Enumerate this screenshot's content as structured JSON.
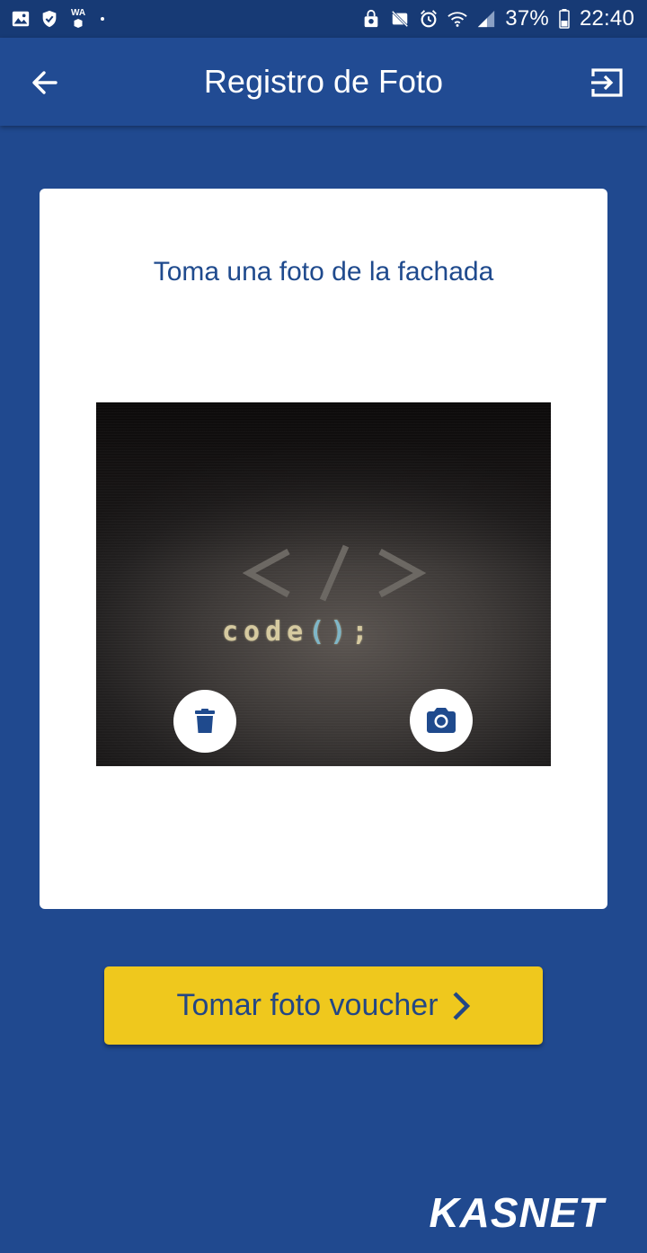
{
  "status_bar": {
    "battery_percent": "37%",
    "time": "22:40",
    "wa_label": "WA"
  },
  "app_bar": {
    "title": "Registro de Foto"
  },
  "card": {
    "title": "Toma una foto de la fachada",
    "photo_code_text": "code",
    "photo_code_parens": "()",
    "photo_code_semicolon": ";"
  },
  "voucher_button": {
    "label": "Tomar foto voucher"
  },
  "brand": {
    "logo_text": "KASNET"
  },
  "colors": {
    "primary": "#214b93",
    "accent": "#efc81d",
    "card_title": "#1f4a8d"
  }
}
